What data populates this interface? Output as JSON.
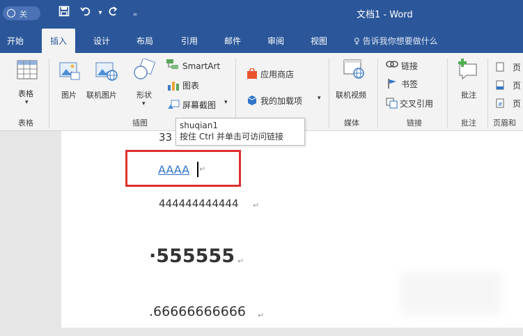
{
  "titlebar": {
    "autosave": "关",
    "title": "文档1  -  Word"
  },
  "tabs": [
    "开始",
    "插入",
    "设计",
    "布局",
    "引用",
    "邮件",
    "审阅",
    "视图"
  ],
  "active_tab": "插入",
  "tell_me": "告诉我你想要做什么",
  "ribbon": {
    "tables": {
      "btn": "表格",
      "group": "表格"
    },
    "illustrations": {
      "pictures": "图片",
      "online_pictures": "联机图片",
      "shapes": "形状",
      "smartart": "SmartArt",
      "chart": "图表",
      "screenshot": "屏幕截图",
      "group": "插图"
    },
    "addins": {
      "store": "应用商店",
      "my_addins": "我的加载项"
    },
    "media": {
      "online_video": "联机视频",
      "group": "媒体"
    },
    "links": {
      "link": "链接",
      "bookmark": "书签",
      "crossref": "交叉引用",
      "group": "链接"
    },
    "comments": {
      "comment": "批注",
      "group": "批注"
    },
    "header_footer": {
      "item1": "页",
      "item2": "页",
      "item3": "页",
      "group": "页眉和"
    }
  },
  "tooltip": {
    "line1": "shuqian1",
    "line2": "按住 Ctrl 并单击可访问链接"
  },
  "document": {
    "line3_partial": "33",
    "hyperlink_text": "AAAA",
    "line4": "444444444444",
    "line5": "·555555",
    "line6": ".66666666666",
    "para_mark": "↵"
  }
}
